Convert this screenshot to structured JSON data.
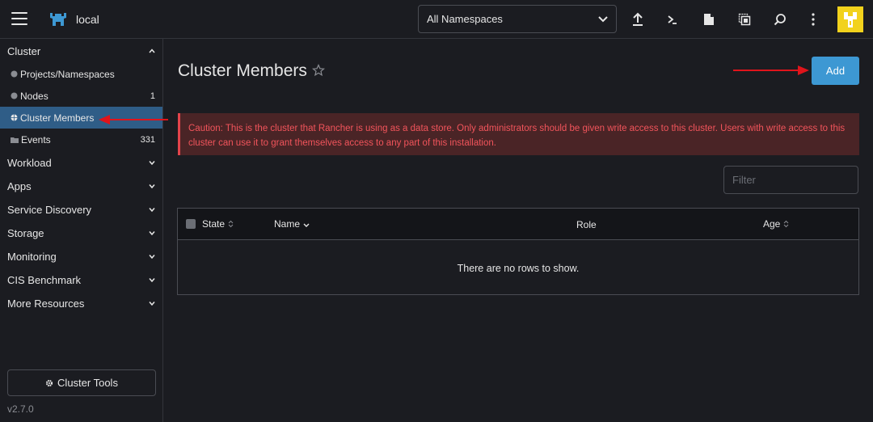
{
  "header": {
    "cluster_name": "local",
    "namespace_select": "All Namespaces",
    "icons": [
      "upload-icon",
      "terminal-icon",
      "file-icon",
      "copy-config-icon",
      "search-icon",
      "more-icon"
    ]
  },
  "sidebar": {
    "groups": [
      {
        "label": "Cluster",
        "expanded": true
      },
      {
        "label": "Workload"
      },
      {
        "label": "Apps"
      },
      {
        "label": "Service Discovery"
      },
      {
        "label": "Storage"
      },
      {
        "label": "Monitoring"
      },
      {
        "label": "CIS Benchmark"
      },
      {
        "label": "More Resources"
      }
    ],
    "items": [
      {
        "label": "Projects/Namespaces",
        "count": ""
      },
      {
        "label": "Nodes",
        "count": "1"
      },
      {
        "label": "Cluster Members",
        "count": "",
        "active": true
      },
      {
        "label": "Events",
        "count": "331"
      }
    ],
    "cluster_tools": "Cluster Tools",
    "version": "v2.7.0"
  },
  "main": {
    "title": "Cluster Members",
    "add_button": "Add",
    "caution": "Caution: This is the cluster that Rancher is using as a data store. Only administrators should be given write access to this cluster. Users with write access to this cluster can use it to grant themselves access to any part of this installation.",
    "filter_placeholder": "Filter",
    "table": {
      "columns": [
        "State",
        "Name",
        "Role",
        "Age"
      ],
      "empty_text": "There are no rows to show."
    }
  },
  "colors": {
    "accent": "#3d98d3",
    "active_item": "#2f5d87",
    "caution_bg": "#4a2426",
    "caution_text": "#f2545b",
    "avatar": "#f2d21c",
    "annotation_arrow": "#e0141b"
  }
}
